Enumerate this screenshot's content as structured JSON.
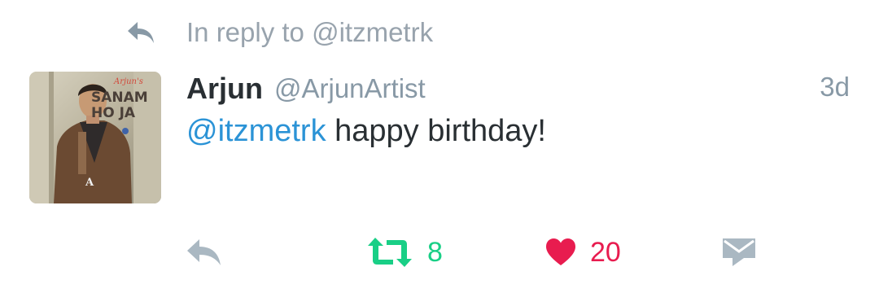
{
  "reply_context": {
    "text": "In reply to @itzmetrk"
  },
  "tweet": {
    "author": {
      "display_name": "Arjun",
      "handle": "@ArjunArtist",
      "avatar": {
        "title_line1": "SANAM",
        "title_line2": "HO JA",
        "script": "Arjun's"
      }
    },
    "timestamp": "3d",
    "mention": "@itzmetrk",
    "text": " happy birthday!"
  },
  "actions": {
    "retweet_count": "8",
    "like_count": "20"
  },
  "colors": {
    "mention": "#2b93d6",
    "retweet": "#19cf86",
    "like": "#e81c4f",
    "muted": "#8899a6"
  }
}
